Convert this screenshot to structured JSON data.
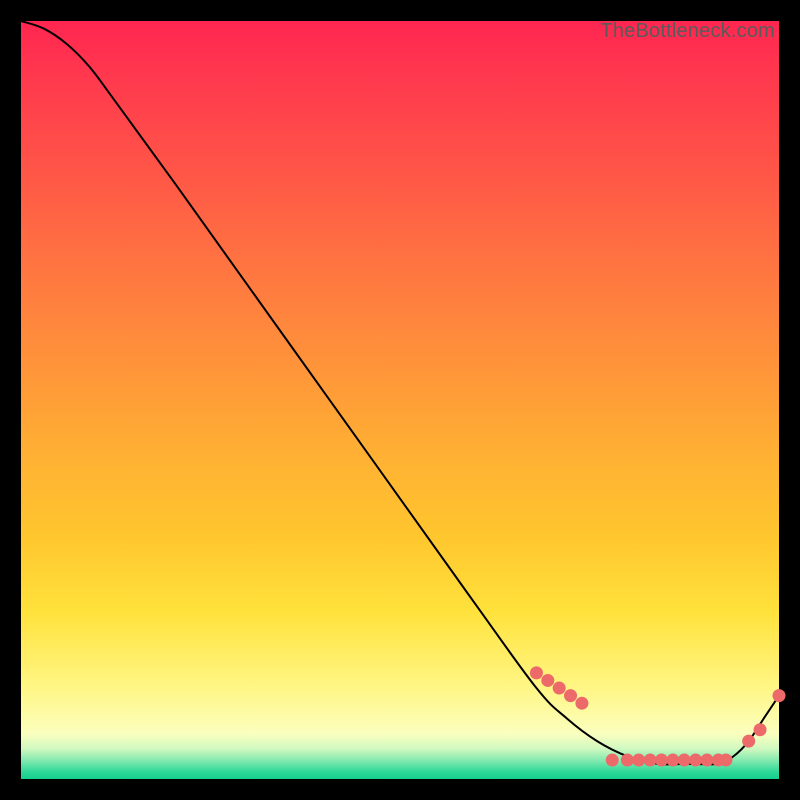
{
  "watermark": "TheBottleneck.com",
  "chart_data": {
    "type": "line",
    "title": "",
    "xlabel": "",
    "ylabel": "",
    "xlim": [
      0,
      100
    ],
    "ylim": [
      0,
      100
    ],
    "grid": false,
    "series": [
      {
        "name": "curve",
        "x": [
          0,
          3,
          6,
          9,
          12,
          20,
          30,
          40,
          50,
          60,
          68,
          72,
          76,
          80,
          84,
          88,
          92,
          94,
          96,
          98,
          100
        ],
        "y": [
          100,
          99,
          97,
          94,
          90,
          79,
          65,
          51,
          37,
          23,
          12,
          8,
          5,
          3,
          2,
          2,
          2,
          3,
          5,
          8,
          11
        ]
      }
    ],
    "highlight_points": {
      "name": "dots",
      "x": [
        68,
        69.5,
        71,
        72.5,
        74,
        78,
        80,
        81.5,
        83,
        84.5,
        86,
        87.5,
        89,
        90.5,
        92,
        93,
        96,
        97.5,
        100
      ],
      "y": [
        14,
        13,
        12,
        11,
        10,
        2.5,
        2.5,
        2.5,
        2.5,
        2.5,
        2.5,
        2.5,
        2.5,
        2.5,
        2.5,
        2.5,
        5,
        6.5,
        11
      ]
    }
  }
}
